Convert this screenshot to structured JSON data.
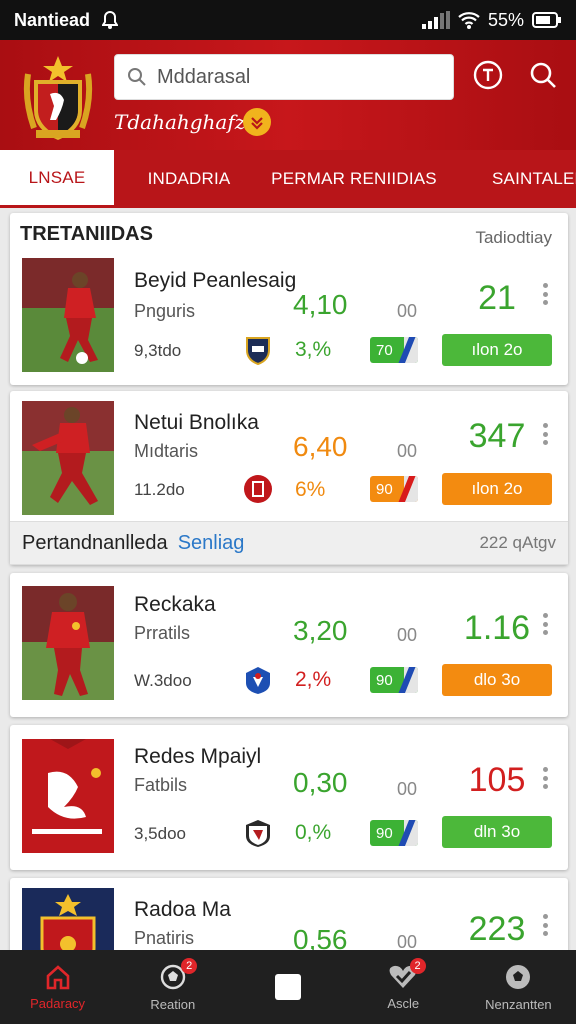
{
  "status": {
    "carrier": "Nantiead",
    "battery": "55%"
  },
  "header": {
    "search_placeholder": "Mddarasal",
    "subtitle": "Tdahahghafz"
  },
  "tabs": [
    {
      "label": "LNSAE"
    },
    {
      "label": "INDADRIA"
    },
    {
      "label": "PERMAR RENIIDIAS"
    },
    {
      "label": "SAINTALEB"
    }
  ],
  "section1": {
    "title": "TRETANIIDAS",
    "subtitle": "Tadiodtiay"
  },
  "section2": {
    "title": "Pertandnanlleda",
    "link": "Senliag",
    "right": "222 qAtgv"
  },
  "players": [
    {
      "name": "Beyid Peanlesaig",
      "position": "Pnguris",
      "value": "9,3tdo",
      "odds": "4,10",
      "odds_suffix": "00",
      "pct": "3,%",
      "pill": "70",
      "score": "21",
      "button": "ılon 2o",
      "odds_color": "#3aa42e",
      "pct_color": "#3aa42e",
      "score_color": "#3aa42e",
      "pill_color": "#3cb235",
      "slash_color": "#1f4bb3",
      "button_color": "#4cb83a"
    },
    {
      "name": "Netui Bnolıka",
      "position": "Mıdtaris",
      "value": "11.2do",
      "odds": "6,40",
      "odds_suffix": "00",
      "pct": "6%",
      "pill": "90",
      "score": "347",
      "button": "ılon 2o",
      "odds_color": "#f08a10",
      "pct_color": "#f08a10",
      "score_color": "#3aa42e",
      "pill_color": "#f38b10",
      "slash_color": "#d81b1b",
      "button_color": "#f38b10"
    },
    {
      "name": "Reckaka",
      "position": "Prratils",
      "value": "W.3doo",
      "odds": "3,20",
      "odds_suffix": "00",
      "pct": "2,%",
      "pill": "90",
      "score": "1.16",
      "button": "dlo 3o",
      "odds_color": "#3aa42e",
      "pct_color": "#d21f1f",
      "score_color": "#3aa42e",
      "pill_color": "#3cb235",
      "slash_color": "#1f4bb3",
      "button_color": "#f38b10"
    },
    {
      "name": "Redes Mpaiyl",
      "position": "Fatbils",
      "value": "3,5doo",
      "odds": "0,30",
      "odds_suffix": "00",
      "pct": "0,%",
      "pill": "90",
      "score": "105",
      "button": "dln 3o",
      "odds_color": "#3aa42e",
      "pct_color": "#3aa42e",
      "score_color": "#d21f1f",
      "pill_color": "#3cb235",
      "slash_color": "#1f4bb3",
      "button_color": "#4cb83a"
    },
    {
      "name": "Radoa Ma",
      "position": "Pnatiris",
      "value": "",
      "odds": "0,56",
      "odds_suffix": "00",
      "pct": "",
      "pill": "",
      "score": "223",
      "button": "",
      "odds_color": "#3aa42e",
      "pct_color": "#3aa42e",
      "score_color": "#3aa42e",
      "pill_color": "#3cb235",
      "slash_color": "#1f4bb3",
      "button_color": "#4cb83a"
    }
  ],
  "nav": [
    {
      "label": "Padaracy",
      "icon": "home-icon",
      "badge": ""
    },
    {
      "label": "Reation",
      "icon": "ball-icon",
      "badge": "2"
    },
    {
      "label": "",
      "icon": "square-icon",
      "badge": ""
    },
    {
      "label": "Ascle",
      "icon": "check-heart-icon",
      "badge": "2"
    },
    {
      "label": "Nenzantten",
      "icon": "ball-icon",
      "badge": ""
    }
  ],
  "colors": {
    "brand": "#b81519",
    "green": "#3aa42e",
    "orange": "#f08a10"
  }
}
